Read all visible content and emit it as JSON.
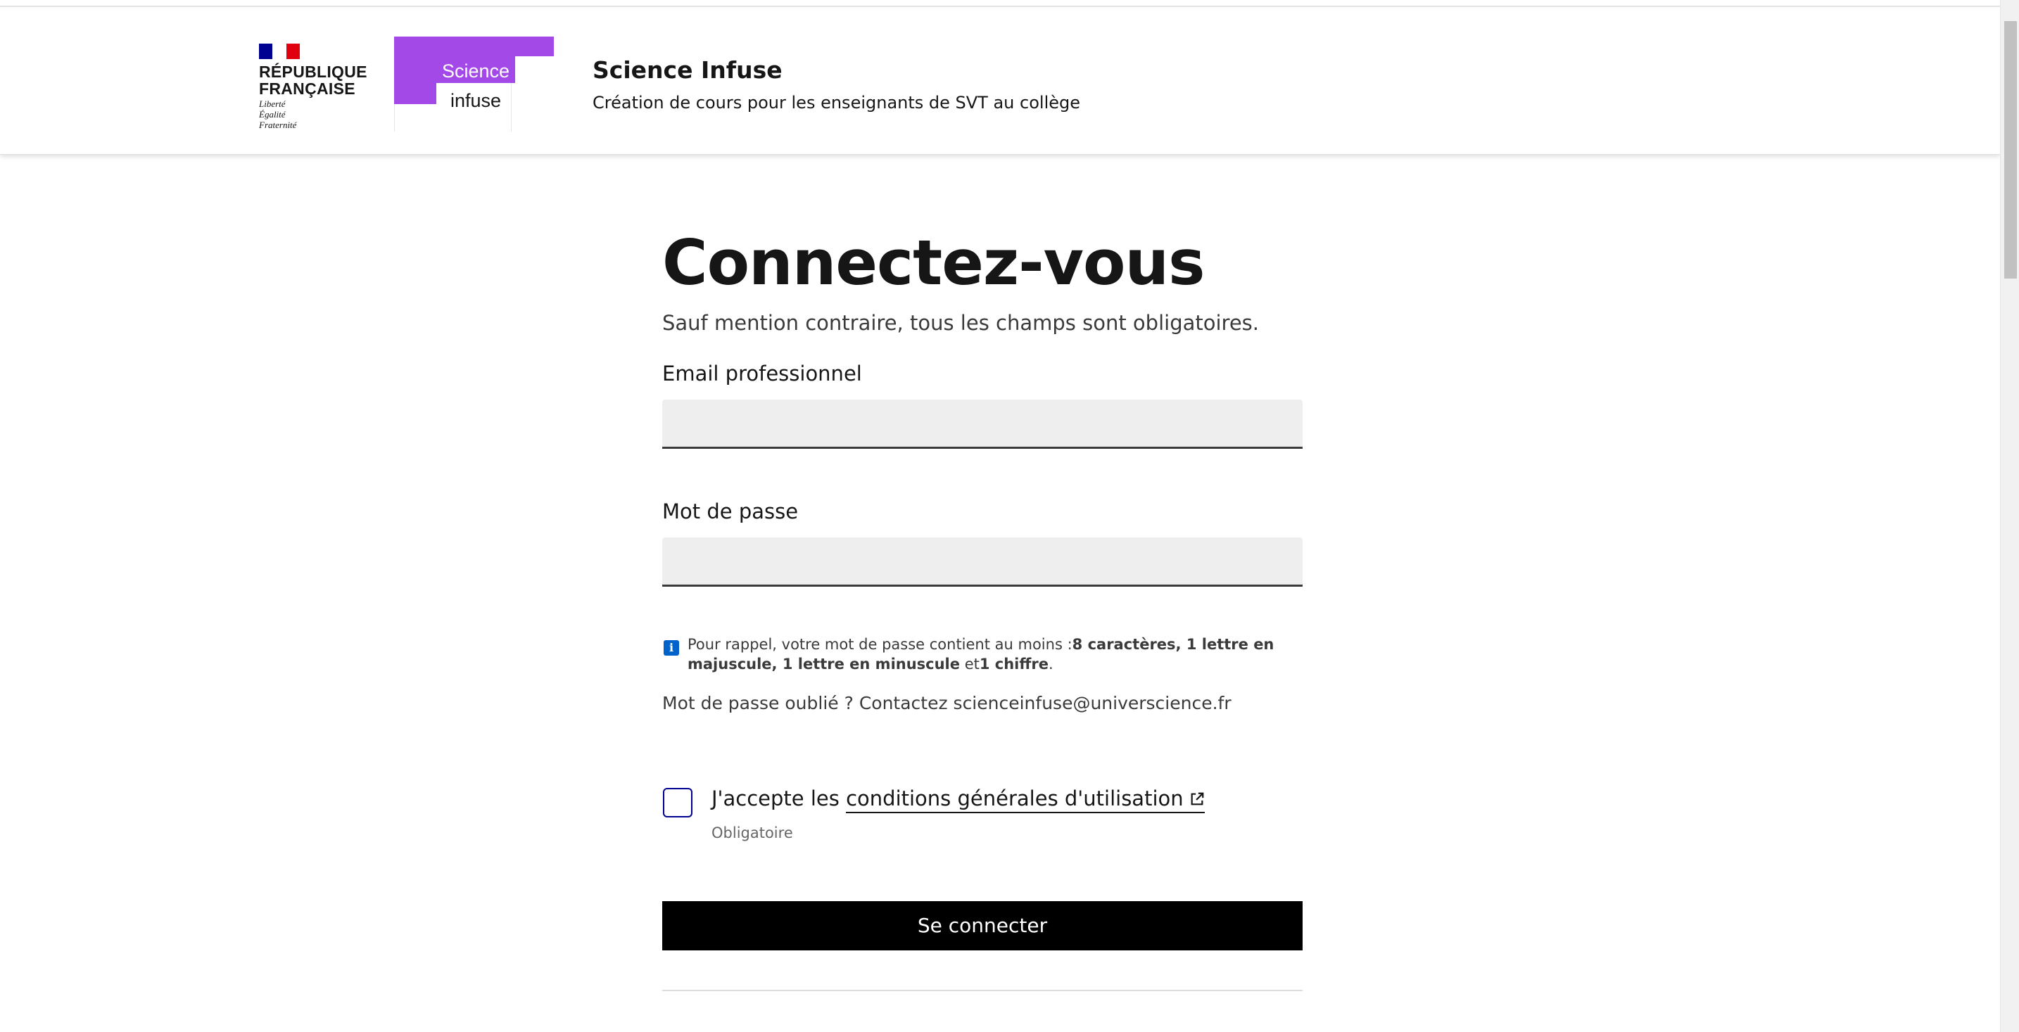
{
  "header": {
    "republic": {
      "name_line1": "RÉPUBLIQUE",
      "name_line2": "FRANÇAISE",
      "motto": [
        "Liberté",
        "Égalité",
        "Fraternité"
      ]
    },
    "operator_logo": {
      "word1": "Science",
      "word2": "infuse",
      "color": "#a349e8"
    },
    "service_title": "Science Infuse",
    "service_tagline": "Création de cours pour les enseignants de SVT au collège"
  },
  "form": {
    "title": "Connectez-vous",
    "hint": "Sauf mention contraire, tous les champs sont obligatoires.",
    "email_label": "Email professionnel",
    "email_value": "",
    "password_label": "Mot de passe",
    "password_value": "",
    "password_info": {
      "prefix": "Pour rappel, votre mot de passe contient au moins :",
      "bold1": "8 caractères, 1 lettre en majuscule, 1 lettre en minuscule",
      "middle": " et",
      "bold2": "1 chiffre",
      "suffix": "."
    },
    "forgot_text": "Mot de passe oublié ? Contactez scienceinfuse@universcience.fr",
    "cgu": {
      "prefix": "J'accepte les ",
      "link": "conditions générales d'utilisation",
      "checked": false,
      "required_hint": "Obligatoire"
    },
    "submit_label": "Se connecter"
  },
  "colors": {
    "accent_blue": "#000091",
    "info_blue": "#0063cb",
    "button_bg": "#000000"
  }
}
